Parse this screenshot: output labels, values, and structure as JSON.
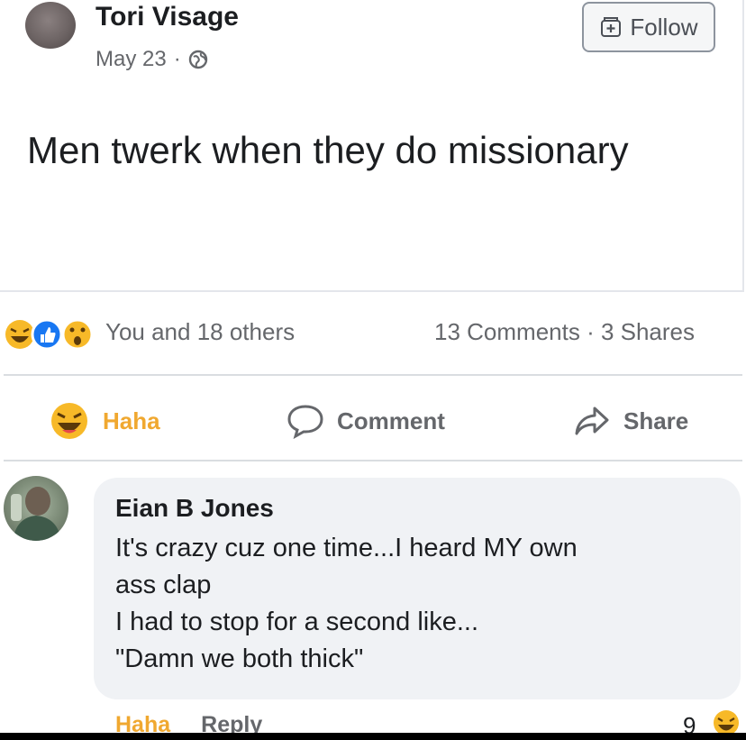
{
  "post": {
    "author_name": "Tori Visage",
    "date": "May 23",
    "meta_separator": "·",
    "follow_label": "Follow",
    "text": "Men twerk when they do missionary"
  },
  "stats": {
    "reactions_text": "You and 18 others",
    "counts_text": "13 Comments · 3 Shares"
  },
  "actions": {
    "haha_label": "Haha",
    "comment_label": "Comment",
    "share_label": "Share"
  },
  "comment": {
    "author_name": "Eian B Jones",
    "lines": [
      "It's crazy cuz one time...I heard MY own",
      "ass clap",
      "I had to stop for a second like...",
      "\"Damn we both thick\""
    ],
    "haha_label": "Haha",
    "reply_label": "Reply",
    "reaction_count": "9"
  },
  "icons": {
    "globe": "globe-icon",
    "follow": "follow-icon",
    "haha": "haha-reaction-icon",
    "like": "like-reaction-icon",
    "wow": "wow-reaction-icon",
    "comment": "comment-bubble-icon",
    "share": "share-arrow-icon"
  },
  "colors": {
    "haha": "#f0a830",
    "like": "#1877f2",
    "muted_text": "#65676b"
  }
}
